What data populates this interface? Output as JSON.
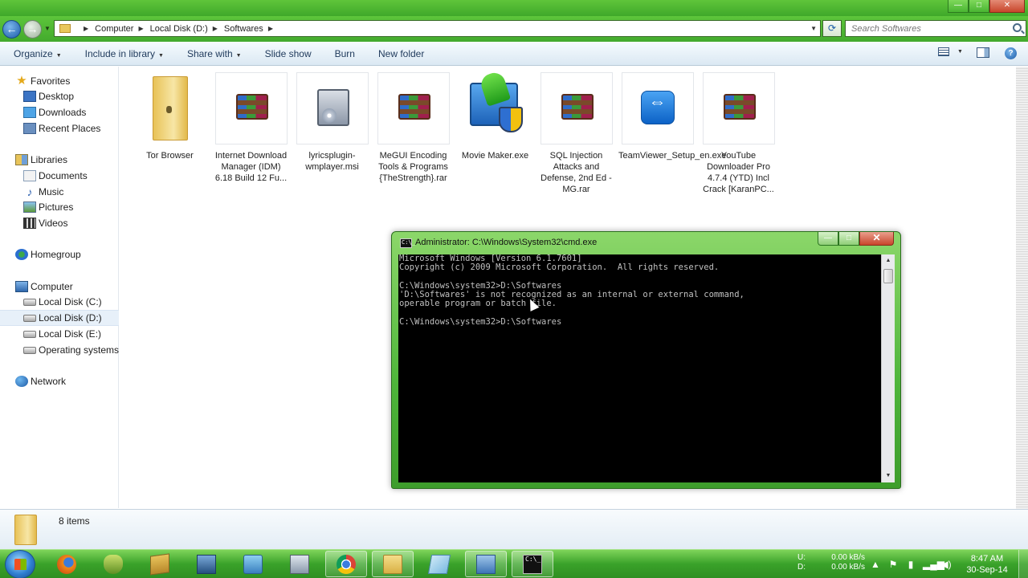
{
  "window": {
    "minimize_glyph": "—",
    "maximize_glyph": "□",
    "close_glyph": "✕"
  },
  "address": {
    "back_glyph": "←",
    "forward_glyph": "→",
    "recent_glyph": "▼",
    "crumbs": [
      "Computer",
      "Local Disk (D:)",
      "Softwares"
    ],
    "separator_glyph": "▶",
    "dropdown_glyph": "▼",
    "refresh_glyph": "⟳",
    "search_placeholder": "Search Softwares"
  },
  "toolbar": {
    "items": [
      "Organize",
      "Include in library",
      "Share with",
      "Slide show",
      "Burn",
      "New folder"
    ],
    "dropdown_glyph": "▼",
    "help_glyph": "?"
  },
  "nav_pane": {
    "favorites": {
      "label": "Favorites",
      "items": [
        "Desktop",
        "Downloads",
        "Recent Places"
      ]
    },
    "libraries": {
      "label": "Libraries",
      "items": [
        "Documents",
        "Music",
        "Pictures",
        "Videos"
      ]
    },
    "homegroup": {
      "label": "Homegroup"
    },
    "computer": {
      "label": "Computer",
      "items": [
        "Local Disk (C:)",
        "Local Disk (D:)",
        "Local Disk (E:)",
        "Operating systems ("
      ]
    },
    "network": {
      "label": "Network"
    },
    "star_glyph": "★",
    "music_glyph": "♪"
  },
  "files": [
    {
      "name": "Tor Browser",
      "icon": "folder-icon"
    },
    {
      "name": "Internet Download Manager (IDM) 6.18 Build 12 Fu...",
      "icon": "winrar-archive-icon"
    },
    {
      "name": "lyricsplugin-wmplayer.msi",
      "icon": "msi-installer-icon"
    },
    {
      "name": "MeGUI Encoding Tools & Programs {TheStrength}.rar",
      "icon": "winrar-archive-icon"
    },
    {
      "name": "Movie Maker.exe",
      "icon": "movie-maker-icon"
    },
    {
      "name": "SQL Injection Attacks and Defense, 2nd Ed - MG.rar",
      "icon": "winrar-archive-icon"
    },
    {
      "name": "TeamViewer_Setup_en.exe",
      "icon": "teamviewer-icon"
    },
    {
      "name": "YouTube Downloader Pro 4.7.4 (YTD) Incl Crack [KaranPC...",
      "icon": "winrar-archive-icon"
    }
  ],
  "status": {
    "count": "8 items"
  },
  "cmd": {
    "icon_text": "C:\\_",
    "title": "Administrator: C:\\Windows\\System32\\cmd.exe",
    "min_glyph": "—",
    "max_glyph": "□",
    "close_glyph": "✕",
    "lines": [
      "Microsoft Windows [Version 6.1.7601]",
      "Copyright (c) 2009 Microsoft Corporation.  All rights reserved.",
      "",
      "C:\\Windows\\system32>D:\\Softwares",
      "'D:\\Softwares' is not recognized as an internal or external command,",
      "operable program or batch file.",
      "",
      "C:\\Windows\\system32>D:\\Softwares"
    ],
    "scroll_up_glyph": "▲",
    "scroll_down_glyph": "▼"
  },
  "taskbar": {
    "cmd_icon_text": "C:\\_",
    "tray": {
      "drive_up": "U:",
      "drive_down": "D:",
      "speed_up": "0.00 kB/s",
      "speed_down": "0.00 kB/s",
      "arrow_glyph": "▲",
      "flag_glyph": "⚑",
      "battery_glyph": "▮",
      "network_glyph": "▂▄▆",
      "volume_glyph": "◀)"
    },
    "clock": {
      "time": "8:47 AM",
      "date": "30-Sep-14"
    }
  }
}
